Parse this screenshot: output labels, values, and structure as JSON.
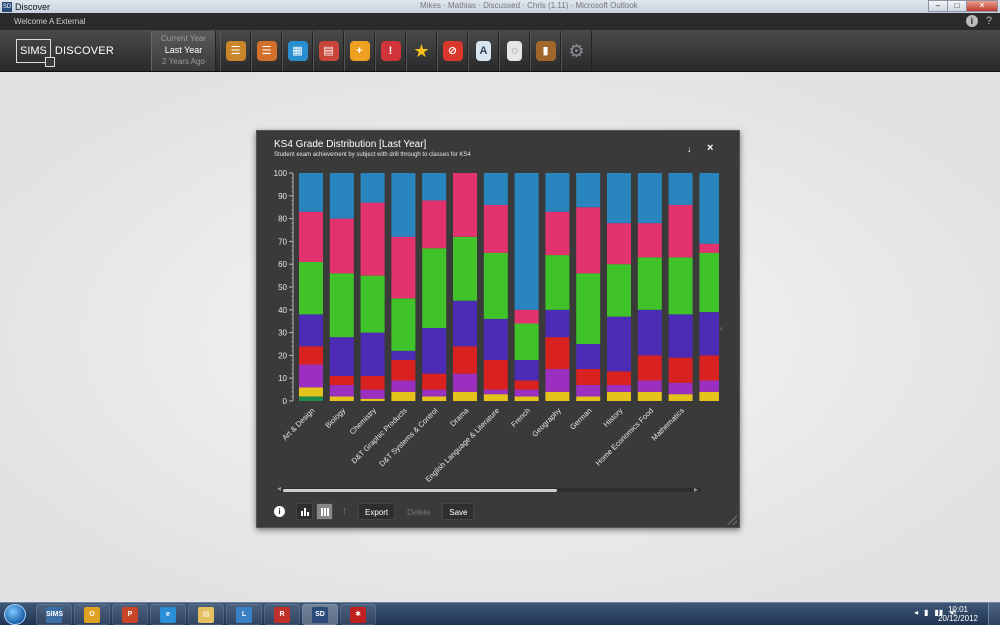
{
  "window": {
    "title": "Discover",
    "app_icon": "SD",
    "center_text": "Mikes · Mathias · Discussed · Chris (1.11) · Microsoft Outlook",
    "controls": [
      "–",
      "□",
      "✕"
    ]
  },
  "welcome": {
    "text": "Welcome A External",
    "help_icons": [
      "i",
      "?"
    ]
  },
  "logo": {
    "box_text": "SIMS",
    "text": "DISCOVER"
  },
  "year_selector": {
    "options": [
      "Current Year",
      "Last Year",
      "2 Years Ago"
    ],
    "selected": "Last Year"
  },
  "toolbar_icons": [
    {
      "name": "contacts-book-icon",
      "glyph": "☰",
      "color": "#c9872c"
    },
    {
      "name": "student-book-icon",
      "glyph": "☰",
      "color": "#d0702a"
    },
    {
      "name": "groups-icon",
      "glyph": "▦",
      "color": "#2a8fcf"
    },
    {
      "name": "calendar-icon",
      "glyph": "▤",
      "color": "#c8453a"
    },
    {
      "name": "add-circle-icon",
      "glyph": "+",
      "color": "#f0a020"
    },
    {
      "name": "alert-speech-icon",
      "glyph": "!",
      "color": "#d0333a"
    },
    {
      "name": "star-icon",
      "glyph": "★",
      "color": "#f6c21b"
    },
    {
      "name": "no-entry-icon",
      "glyph": "⊘",
      "color": "#d9372b"
    },
    {
      "name": "document-letter-icon",
      "glyph": "A",
      "color": "#d8e6f2"
    },
    {
      "name": "document-search-icon",
      "glyph": "◌",
      "color": "#e6e6e6"
    },
    {
      "name": "folder-book-icon",
      "glyph": "▮",
      "color": "#a0662a"
    },
    {
      "name": "gear-icon",
      "glyph": "⚙",
      "color": "#8a8f96"
    }
  ],
  "dialog": {
    "title": "KS4 Grade Distribution [Last Year]",
    "subtitle": "Student exam achievement by subject with drill through to classes for KS4",
    "download_glyph": "↓",
    "close_glyph": "×",
    "footer": {
      "info_glyph": "i",
      "up_glyph": "↑",
      "export_label": "Export",
      "delete_label": "Delete",
      "save_label": "Save"
    },
    "scroll_left": "◂",
    "scroll_right": "▸"
  },
  "chart_data": {
    "type": "bar",
    "stacked": true,
    "title": "",
    "xlabel": "",
    "ylabel": "",
    "ylim": [
      0,
      100
    ],
    "yticks": [
      0,
      10,
      20,
      30,
      40,
      50,
      60,
      70,
      80,
      90,
      100
    ],
    "categories": [
      "Art & Design",
      "Biology",
      "Chemistry",
      "D&T Graphic Products",
      "D&T Systems & Control",
      "Drama",
      "English Language & Literature",
      "French",
      "Geography",
      "German",
      "History",
      "Home Economics Food",
      "Mathematics",
      ""
    ],
    "series_colors": [
      "#1e8a4a",
      "#e6c21c",
      "#9a2fc0",
      "#d92220",
      "#4c2cb4",
      "#40c22a",
      "#e3336e",
      "#2a85bf"
    ],
    "stacks": [
      [
        2,
        4,
        10,
        8,
        14,
        23,
        22,
        17
      ],
      [
        0,
        2,
        5,
        4,
        17,
        28,
        24,
        20
      ],
      [
        0,
        1,
        4,
        6,
        19,
        25,
        32,
        13
      ],
      [
        0,
        4,
        5,
        9,
        4,
        23,
        27,
        28
      ],
      [
        0,
        2,
        3,
        7,
        20,
        35,
        21,
        12
      ],
      [
        0,
        4,
        8,
        12,
        20,
        28,
        28,
        0
      ],
      [
        0,
        3,
        2,
        13,
        18,
        29,
        21,
        14
      ],
      [
        0,
        2,
        3,
        4,
        9,
        16,
        6,
        60
      ],
      [
        0,
        4,
        10,
        14,
        12,
        24,
        19,
        17
      ],
      [
        0,
        2,
        5,
        7,
        11,
        31,
        29,
        15
      ],
      [
        0,
        4,
        3,
        6,
        24,
        23,
        18,
        22
      ],
      [
        0,
        4,
        5,
        11,
        20,
        23,
        15,
        22
      ],
      [
        0,
        3,
        5,
        11,
        19,
        25,
        23,
        14
      ],
      [
        0,
        4,
        5,
        11,
        19,
        26,
        4,
        31
      ]
    ]
  },
  "taskbar": {
    "items": [
      {
        "name": "sims-taskbar-item",
        "label": "SIMS",
        "color": "#3a6ea5"
      },
      {
        "name": "outlook-taskbar-item",
        "label": "O",
        "color": "#e0a020"
      },
      {
        "name": "powerpoint-taskbar-item",
        "label": "P",
        "color": "#c8452a"
      },
      {
        "name": "ie-taskbar-item",
        "label": "e",
        "color": "#2a8fd6"
      },
      {
        "name": "explorer-taskbar-item",
        "label": "▤",
        "color": "#e6c060"
      },
      {
        "name": "lync-taskbar-item",
        "label": "L",
        "color": "#3a7fc4"
      },
      {
        "name": "remote-taskbar-item",
        "label": "R",
        "color": "#c0302a"
      },
      {
        "name": "discover-taskbar-item",
        "label": "SD",
        "color": "#2a4a7a"
      },
      {
        "name": "paint-taskbar-item",
        "label": "✱",
        "color": "#c02020"
      }
    ],
    "tray": [
      "◂",
      "▮",
      "▮▮",
      "◂)"
    ],
    "time": "10:01",
    "date": "20/12/2012"
  }
}
